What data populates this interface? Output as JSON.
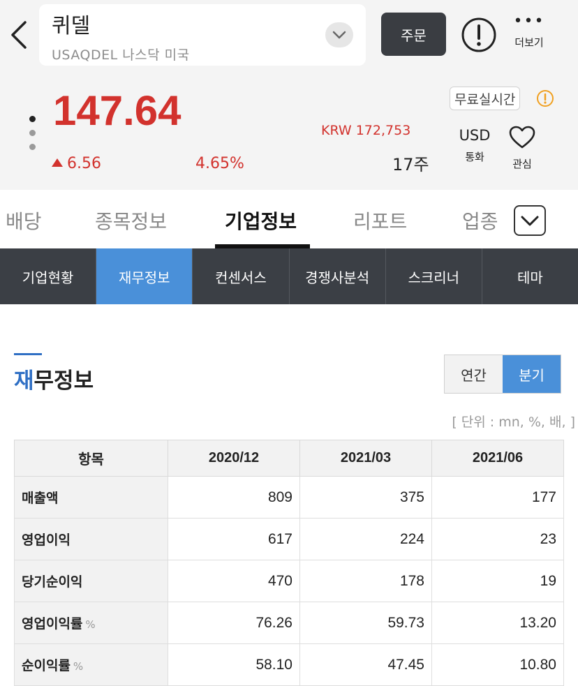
{
  "header": {
    "stock_name": "퀴델",
    "stock_sub": "USAQDEL 나스닥 미국",
    "order_label": "주문",
    "more_label": "더보기",
    "price": "147.64",
    "change": "6.56",
    "change_pct": "4.65%",
    "krw": "KRW 172,753",
    "shares": "17주",
    "realtime_label": "무료실시간",
    "currency_code": "USD",
    "currency_label": "통화",
    "favorite_label": "관심"
  },
  "tabs": [
    {
      "label": "배당"
    },
    {
      "label": "종목정보"
    },
    {
      "label": "기업정보"
    },
    {
      "label": "리포트"
    },
    {
      "label": "업종"
    }
  ],
  "subnav": [
    {
      "label": "기업현황"
    },
    {
      "label": "재무정보"
    },
    {
      "label": "컨센서스"
    },
    {
      "label": "경쟁사분석"
    },
    {
      "label": "스크리너"
    },
    {
      "label": "테마"
    }
  ],
  "section": {
    "title_first": "재",
    "title_rest": "무정보",
    "period_annual": "연간",
    "period_quarter": "분기",
    "unit": "[ 단위 : mn, %, 배, ]"
  },
  "table": {
    "headers": [
      "항목",
      "2020/12",
      "2021/03",
      "2021/06"
    ],
    "rows": [
      {
        "label": "매출액",
        "unit": "",
        "values": [
          "809",
          "375",
          "177"
        ]
      },
      {
        "label": "영업이익",
        "unit": "",
        "values": [
          "617",
          "224",
          "23"
        ]
      },
      {
        "label": "당기순이익",
        "unit": "",
        "values": [
          "470",
          "178",
          "19"
        ]
      },
      {
        "label": "영업이익률",
        "unit": "%",
        "values": [
          "76.26",
          "59.73",
          "13.20"
        ]
      },
      {
        "label": "순이익률",
        "unit": "%",
        "values": [
          "58.10",
          "47.45",
          "10.80"
        ]
      }
    ]
  },
  "colors": {
    "up_red": "#d2322d",
    "accent_blue": "#4a90d9",
    "subnav_dark": "#3b3f45"
  }
}
